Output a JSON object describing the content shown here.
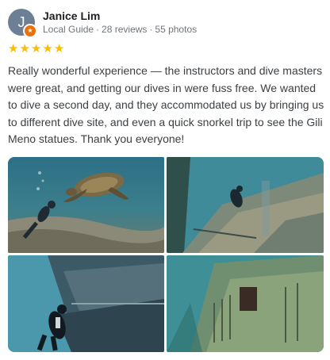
{
  "reviewer": {
    "initial": "J",
    "name": "Janice Lim",
    "badge": "Local Guide",
    "reviews": "28 reviews",
    "photos": "55 photos"
  },
  "rating": {
    "stars": 5,
    "max": 5,
    "star_color": "#fbbc04"
  },
  "review_text": "Really wonderful experience — the instructors and dive masters were great, and getting our dives in were fuss free. We wanted to dive a second day, and they accommodated us by bringing us to different dive site, and even a quick snorkel trip to see the Gili Meno statues. Thank you everyone!",
  "photo_grid": [
    {
      "subject": "sea-turtle-and-diver"
    },
    {
      "subject": "diver-on-wreck"
    },
    {
      "subject": "diver-near-wreck-hull"
    },
    {
      "subject": "shipwreck-deck"
    }
  ],
  "colors": {
    "avatar": "#6d7f95",
    "badge": "#e8710a",
    "text": "#3c4043",
    "secondary": "#70757a"
  }
}
